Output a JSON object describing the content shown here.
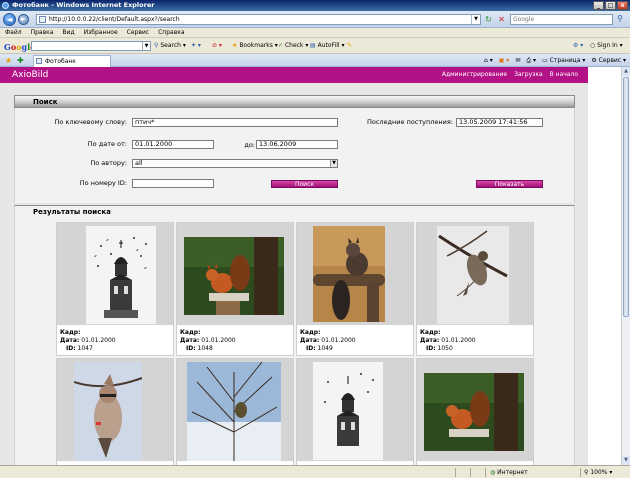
{
  "window": {
    "title": "Фотобанк - Windows Internet Explorer",
    "minimize": "_",
    "maximize": "□",
    "close": "x"
  },
  "address": {
    "url": "http://10.0.0.22/client/Default.aspx?/search",
    "search_placeholder": "Google"
  },
  "menu": [
    "Файл",
    "Правка",
    "Вид",
    "Избранное",
    "Сервис",
    "Справка"
  ],
  "google_toolbar": {
    "search_label": "Search",
    "bookmarks": "Bookmarks",
    "check": "Check",
    "autofill": "AutoFill",
    "signin": "Sign In"
  },
  "tab": {
    "label": "Фотобанк"
  },
  "tab_tools": {
    "page": "Страница",
    "service": "Сервис"
  },
  "app": {
    "logo": "AxioBild",
    "nav": [
      "Администрирование",
      "Загрузка",
      "В начало"
    ]
  },
  "search": {
    "section_title": "Поиск",
    "keyword_label": "По ключевому слову:",
    "keyword_value": "птич*",
    "date_from_label": "По дате от:",
    "date_from_value": "01.01.2000",
    "date_to_label": "до:",
    "date_to_value": "13.06.2009",
    "author_label": "По автору:",
    "author_value": "all",
    "id_label": "По номеру ID:",
    "id_value": "",
    "recent_label": "Последние поступления:",
    "recent_value": "13.05.2009 17:41:56",
    "search_button": "Поиск",
    "show_button": "Показать"
  },
  "results": {
    "section_title": "Результаты поиска",
    "frame_label": "Кадр:",
    "date_label": "Дата:",
    "id_label": "ID:",
    "items": [
      {
        "date": "01.01.2000",
        "id": "1047"
      },
      {
        "date": "01.01.2000",
        "id": "1048"
      },
      {
        "date": "01.01.2000",
        "id": "1049"
      },
      {
        "date": "01.01.2000",
        "id": "1050"
      }
    ]
  },
  "status": {
    "zone": "Интернет",
    "zoom": "100%"
  }
}
